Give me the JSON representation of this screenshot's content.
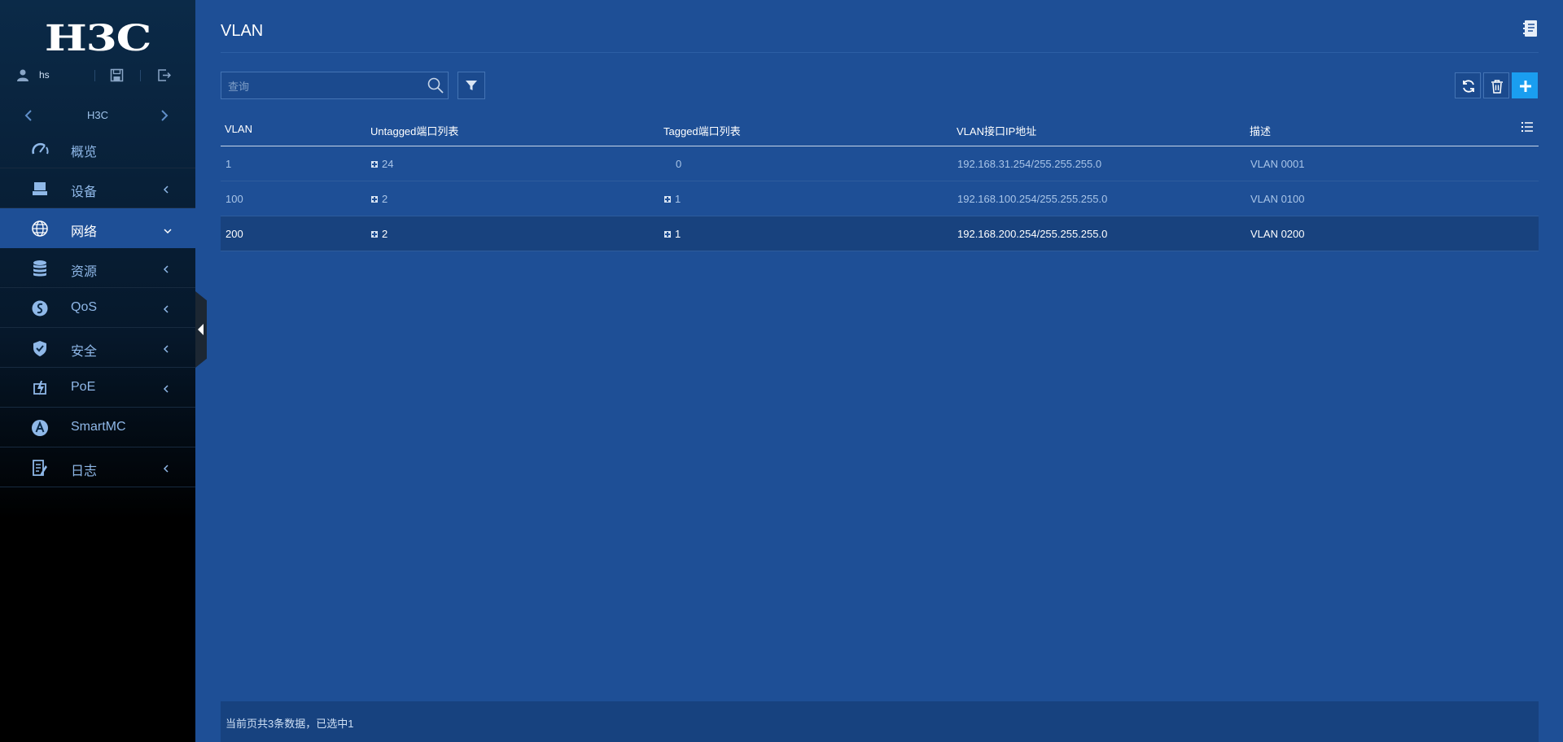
{
  "sidebar": {
    "logo": "H3C",
    "user": {
      "name": "hs"
    },
    "device": {
      "name": "H3C"
    },
    "items": [
      {
        "label": "概览",
        "icon": "dashboard-icon"
      },
      {
        "label": "设备",
        "icon": "device-icon"
      },
      {
        "label": "网络",
        "icon": "globe-icon",
        "active": true
      },
      {
        "label": "资源",
        "icon": "database-icon"
      },
      {
        "label": "QoS",
        "icon": "qos-icon"
      },
      {
        "label": "安全",
        "icon": "shield-icon"
      },
      {
        "label": "PoE",
        "icon": "poe-icon"
      },
      {
        "label": "SmartMC",
        "icon": "smartmc-icon"
      },
      {
        "label": "日志",
        "icon": "log-icon"
      }
    ]
  },
  "main": {
    "title": "VLAN",
    "search": {
      "placeholder": "查询",
      "value": ""
    },
    "table": {
      "columns": [
        "VLAN",
        "Untagged端口列表",
        "Tagged端口列表",
        "VLAN接口IP地址",
        "描述"
      ],
      "rows": [
        {
          "vlan": "1",
          "untagged": "24",
          "tagged": "0",
          "ip": "192.168.31.254/255.255.255.0",
          "desc": "VLAN 0001",
          "selected": false
        },
        {
          "vlan": "100",
          "untagged": "2",
          "tagged": "1",
          "ip": "192.168.100.254/255.255.255.0",
          "desc": "VLAN 0100",
          "selected": false
        },
        {
          "vlan": "200",
          "untagged": "2",
          "tagged": "1",
          "ip": "192.168.200.254/255.255.255.0",
          "desc": "VLAN 0200",
          "selected": true
        }
      ]
    },
    "footer": {
      "text": "当前页共3条数据，已选中1"
    }
  },
  "colors": {
    "background": "#1e4f96",
    "sidebar": "#0b2a48",
    "accent": "#1a9ef0",
    "selected_row": "#18427e"
  }
}
